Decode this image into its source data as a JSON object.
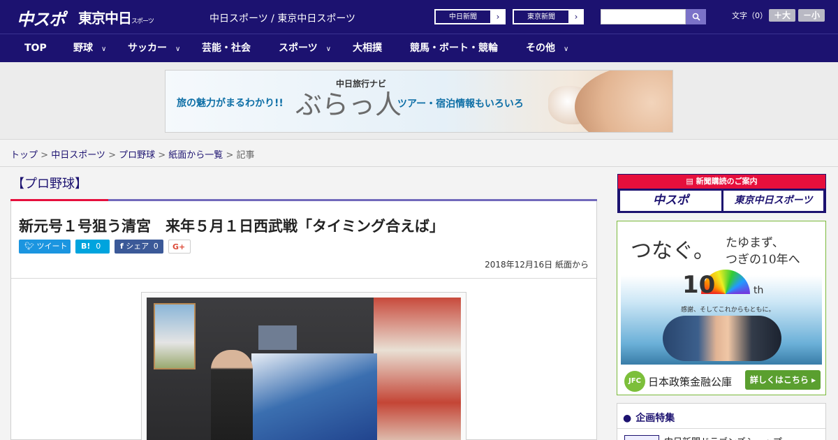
{
  "header": {
    "logo_main": "中スポ",
    "logo_tokyo": "東京中日",
    "logo_tokyo_sub": "スポーツ",
    "site_title": "中日スポーツ / 東京中日スポーツ",
    "paper_links": [
      {
        "label": "中日新聞"
      },
      {
        "label": "東京新聞"
      }
    ],
    "search": {
      "placeholder": ""
    },
    "font_size_label": "文字（0）",
    "font_increase": "＋大",
    "font_decrease": "－小"
  },
  "nav": {
    "items": [
      {
        "label": "TOP",
        "has_menu": false
      },
      {
        "label": "野球",
        "has_menu": true
      },
      {
        "label": "サッカー",
        "has_menu": true
      },
      {
        "label": "芸能・社会",
        "has_menu": false
      },
      {
        "label": "スポーツ",
        "has_menu": true
      },
      {
        "label": "大相撲",
        "has_menu": false
      },
      {
        "label": "競馬・ボート・競輪",
        "has_menu": false
      },
      {
        "label": "その他",
        "has_menu": true
      }
    ]
  },
  "ad_banner": {
    "small_text": "中日旅行ナビ",
    "text_left": "旅の魅力がまるわかり!!",
    "brand": "ぶらっ人",
    "text_right": "ツアー・宿泊情報もいろいろ"
  },
  "breadcrumb": {
    "items": [
      "トップ",
      "中日スポーツ",
      "プロ野球",
      "紙面から一覧"
    ],
    "current": "記事",
    "separator": " > "
  },
  "article": {
    "category": "【プロ野球】",
    "headline": "新元号１号狙う清宮　来年５月１日西武戦「タイミング合えば」",
    "share": {
      "tweet_label": "ツイート",
      "hatena_label": "B!",
      "hatena_count": "0",
      "facebook_label": "シェア",
      "facebook_count": "0",
      "gplus_label": "G+"
    },
    "date": "2018年12月16日 紙面から"
  },
  "sidebar": {
    "subscription": {
      "header": "新聞購読のご案内",
      "buttons": [
        "中スポ",
        "東京中日スポーツ"
      ]
    },
    "ad": {
      "headline": "つなぐ。",
      "tagline": "たゆまず、\nつぎの10年へ",
      "big_number": "10",
      "suffix": "th",
      "thanks": "感謝、そしてこれからもともに。",
      "org_mark": "JFC",
      "org_name": "日本政策金融公庫",
      "cta": "詳しくはこちら ▸"
    },
    "features": {
      "title": "企画特集",
      "item": "中日新聞ドラゴンズショップ"
    }
  },
  "colors": {
    "brand_navy": "#1c1270",
    "accent_red": "#e60f3c",
    "accent_purple": "#7169bb",
    "twitter_blue": "#1b95e0",
    "hatena_blue": "#00a4de",
    "facebook_blue": "#3b5998",
    "jfc_green": "#5a9f2f"
  },
  "icons": {
    "search": "search-icon",
    "chevron": "chevron-down-icon",
    "arrow": "chevron-right-icon",
    "twitter": "twitter-icon",
    "facebook": "facebook-icon",
    "pin": "pin-icon"
  }
}
